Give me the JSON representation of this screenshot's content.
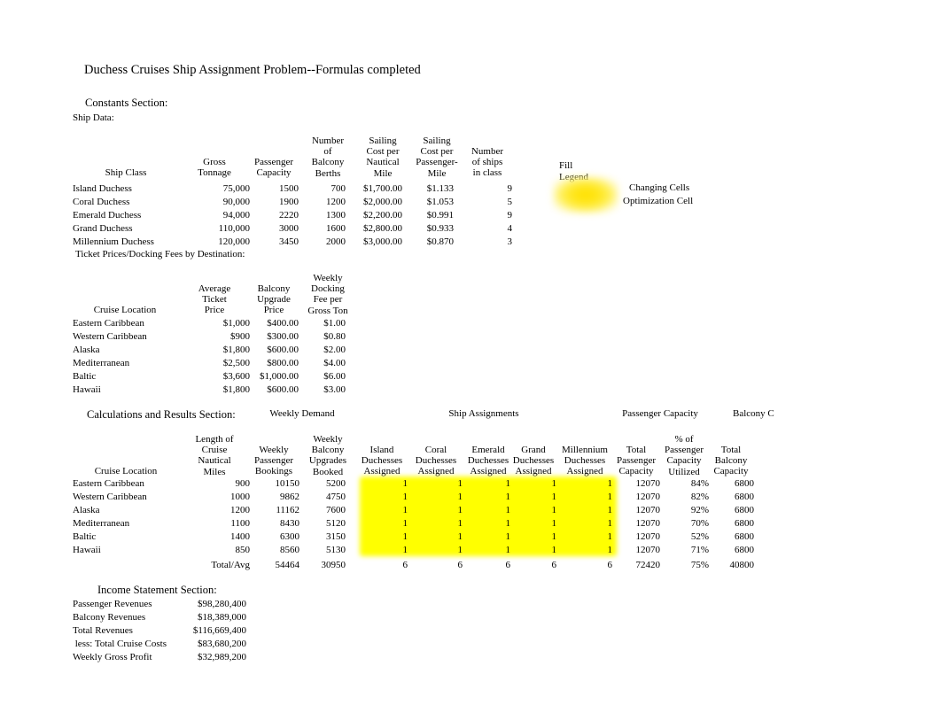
{
  "document": {
    "title": "Duchess Cruises Ship Assignment Problem--Formulas completed"
  },
  "constants": {
    "section_label": "Constants Section:",
    "ship_data_label": "Ship Data:",
    "ship_table": {
      "headers": [
        [
          "Ship Class"
        ],
        [
          "Gross",
          "Tonnage"
        ],
        [
          "Passenger",
          "Capacity"
        ],
        [
          "Number",
          "of",
          "Balcony",
          "Berths"
        ],
        [
          "Sailing",
          "Cost per",
          "Nautical",
          "Mile"
        ],
        [
          "Sailing",
          "Cost per",
          "Passenger-",
          "Mile"
        ],
        [
          "Number",
          "of ships",
          "in class"
        ]
      ],
      "rows": [
        {
          "ship_class": "Island Duchess",
          "gross_tonnage": "75,000",
          "passenger_capacity": "1500",
          "balcony_berths": "700",
          "sailing_cost_nautical_mile": "$1,700.00",
          "sailing_cost_passenger_mile": "$1.133",
          "ships_in_class": "9"
        },
        {
          "ship_class": "Coral Duchess",
          "gross_tonnage": "90,000",
          "passenger_capacity": "1900",
          "balcony_berths": "1200",
          "sailing_cost_nautical_mile": "$2,000.00",
          "sailing_cost_passenger_mile": "$1.053",
          "ships_in_class": "5"
        },
        {
          "ship_class": "Emerald Duchess",
          "gross_tonnage": "94,000",
          "passenger_capacity": "2220",
          "balcony_berths": "1300",
          "sailing_cost_nautical_mile": "$2,200.00",
          "sailing_cost_passenger_mile": "$0.991",
          "ships_in_class": "9"
        },
        {
          "ship_class": "Grand Duchess",
          "gross_tonnage": "110,000",
          "passenger_capacity": "3000",
          "balcony_berths": "1600",
          "sailing_cost_nautical_mile": "$2,800.00",
          "sailing_cost_passenger_mile": "$0.933",
          "ships_in_class": "4"
        },
        {
          "ship_class": "Millennium Duchess",
          "gross_tonnage": "120,000",
          "passenger_capacity": "3450",
          "balcony_berths": "2000",
          "sailing_cost_nautical_mile": "$3,000.00",
          "sailing_cost_passenger_mile": "$0.870",
          "ships_in_class": "3"
        }
      ]
    },
    "ticket_label": "Ticket Prices/Docking Fees by Destination:",
    "ticket_table": {
      "headers": [
        [
          "Cruise Location"
        ],
        [
          "Average",
          "Ticket",
          "Price"
        ],
        [
          "Balcony",
          "Upgrade",
          "Price"
        ],
        [
          "Weekly",
          "Docking",
          "Fee per",
          "Gross Ton"
        ]
      ],
      "rows": [
        {
          "location": "Eastern Caribbean",
          "ticket_price": "$1,000",
          "balcony_upgrade": "$400.00",
          "docking_fee": "$1.00"
        },
        {
          "location": "Western Caribbean",
          "ticket_price": "$900",
          "balcony_upgrade": "$300.00",
          "docking_fee": "$0.80"
        },
        {
          "location": "Alaska",
          "ticket_price": "$1,800",
          "balcony_upgrade": "$600.00",
          "docking_fee": "$2.00"
        },
        {
          "location": "Mediterranean",
          "ticket_price": "$2,500",
          "balcony_upgrade": "$800.00",
          "docking_fee": "$4.00"
        },
        {
          "location": "Baltic",
          "ticket_price": "$3,600",
          "balcony_upgrade": "$1,000.00",
          "docking_fee": "$6.00"
        },
        {
          "location": "Hawaii",
          "ticket_price": "$1,800",
          "balcony_upgrade": "$600.00",
          "docking_fee": "$3.00"
        }
      ]
    }
  },
  "legend": {
    "title_line1": "Fill",
    "title_line2": "Legend",
    "changing_cells": "Changing Cells",
    "optimization_cell": "Optimization Cell",
    "fill_color": "#ffff00"
  },
  "calculations": {
    "section_label": "Calculations and Results Section:",
    "group_headers": {
      "weekly_demand": "Weekly Demand",
      "ship_assignments": "Ship Assignments",
      "passenger_capacity": "Passenger Capacity",
      "balcony_capacity": "Balcony C"
    },
    "headers": [
      [
        "Cruise Location"
      ],
      [
        "Length of",
        "Cruise",
        "Nautical",
        "Miles"
      ],
      [
        "Weekly",
        "Passenger",
        "Bookings"
      ],
      [
        "Weekly",
        "Balcony",
        "Upgrades",
        "Booked"
      ],
      [
        "Island",
        "Duchesses",
        "Assigned"
      ],
      [
        "Coral",
        "Duchesses",
        "Assigned"
      ],
      [
        "Emerald",
        "Duchesses",
        "Assigned"
      ],
      [
        "Grand",
        "Duchesses",
        "Assigned"
      ],
      [
        "Millennium",
        "Duchesses",
        "Assigned"
      ],
      [
        "Total",
        "Passenger",
        "Capacity"
      ],
      [
        "% of",
        "Passenger",
        "Capacity",
        "Utilized"
      ],
      [
        "Total",
        "Balcony",
        "Capacity"
      ]
    ],
    "rows": [
      {
        "location": "Eastern Caribbean",
        "nautical_miles": "900",
        "passenger_bookings": "10150",
        "balcony_upgrades": "5200",
        "island": "1",
        "coral": "1",
        "emerald": "1",
        "grand": "1",
        "millennium": "1",
        "total_passenger_capacity": "12070",
        "pct_capacity_utilized": "84%",
        "total_balcony_capacity": "6800"
      },
      {
        "location": "Western Caribbean",
        "nautical_miles": "1000",
        "passenger_bookings": "9862",
        "balcony_upgrades": "4750",
        "island": "1",
        "coral": "1",
        "emerald": "1",
        "grand": "1",
        "millennium": "1",
        "total_passenger_capacity": "12070",
        "pct_capacity_utilized": "82%",
        "total_balcony_capacity": "6800"
      },
      {
        "location": "Alaska",
        "nautical_miles": "1200",
        "passenger_bookings": "11162",
        "balcony_upgrades": "7600",
        "island": "1",
        "coral": "1",
        "emerald": "1",
        "grand": "1",
        "millennium": "1",
        "total_passenger_capacity": "12070",
        "pct_capacity_utilized": "92%",
        "total_balcony_capacity": "6800"
      },
      {
        "location": "Mediterranean",
        "nautical_miles": "1100",
        "passenger_bookings": "8430",
        "balcony_upgrades": "5120",
        "island": "1",
        "coral": "1",
        "emerald": "1",
        "grand": "1",
        "millennium": "1",
        "total_passenger_capacity": "12070",
        "pct_capacity_utilized": "70%",
        "total_balcony_capacity": "6800"
      },
      {
        "location": "Baltic",
        "nautical_miles": "1400",
        "passenger_bookings": "6300",
        "balcony_upgrades": "3150",
        "island": "1",
        "coral": "1",
        "emerald": "1",
        "grand": "1",
        "millennium": "1",
        "total_passenger_capacity": "12070",
        "pct_capacity_utilized": "52%",
        "total_balcony_capacity": "6800"
      },
      {
        "location": "Hawaii",
        "nautical_miles": "850",
        "passenger_bookings": "8560",
        "balcony_upgrades": "5130",
        "island": "1",
        "coral": "1",
        "emerald": "1",
        "grand": "1",
        "millennium": "1",
        "total_passenger_capacity": "12070",
        "pct_capacity_utilized": "71%",
        "total_balcony_capacity": "6800"
      }
    ],
    "total_row": {
      "label": "Total/Avg",
      "passenger_bookings": "54464",
      "balcony_upgrades": "30950",
      "island": "6",
      "coral": "6",
      "emerald": "6",
      "grand": "6",
      "millennium": "6",
      "total_passenger_capacity": "72420",
      "pct_capacity_utilized": "75%",
      "total_balcony_capacity": "40800"
    }
  },
  "income_statement": {
    "section_label": "Income Statement Section:",
    "rows": [
      {
        "label": "Passenger Revenues",
        "value": "$98,280,400"
      },
      {
        "label": "Balcony Revenues",
        "value": "$18,389,000"
      },
      {
        "label": "Total Revenues",
        "value": "$116,669,400"
      },
      {
        "label": " less: Total Cruise Costs",
        "value": "$83,680,200"
      },
      {
        "label": "Weekly Gross Profit",
        "value": "$32,989,200"
      }
    ]
  }
}
